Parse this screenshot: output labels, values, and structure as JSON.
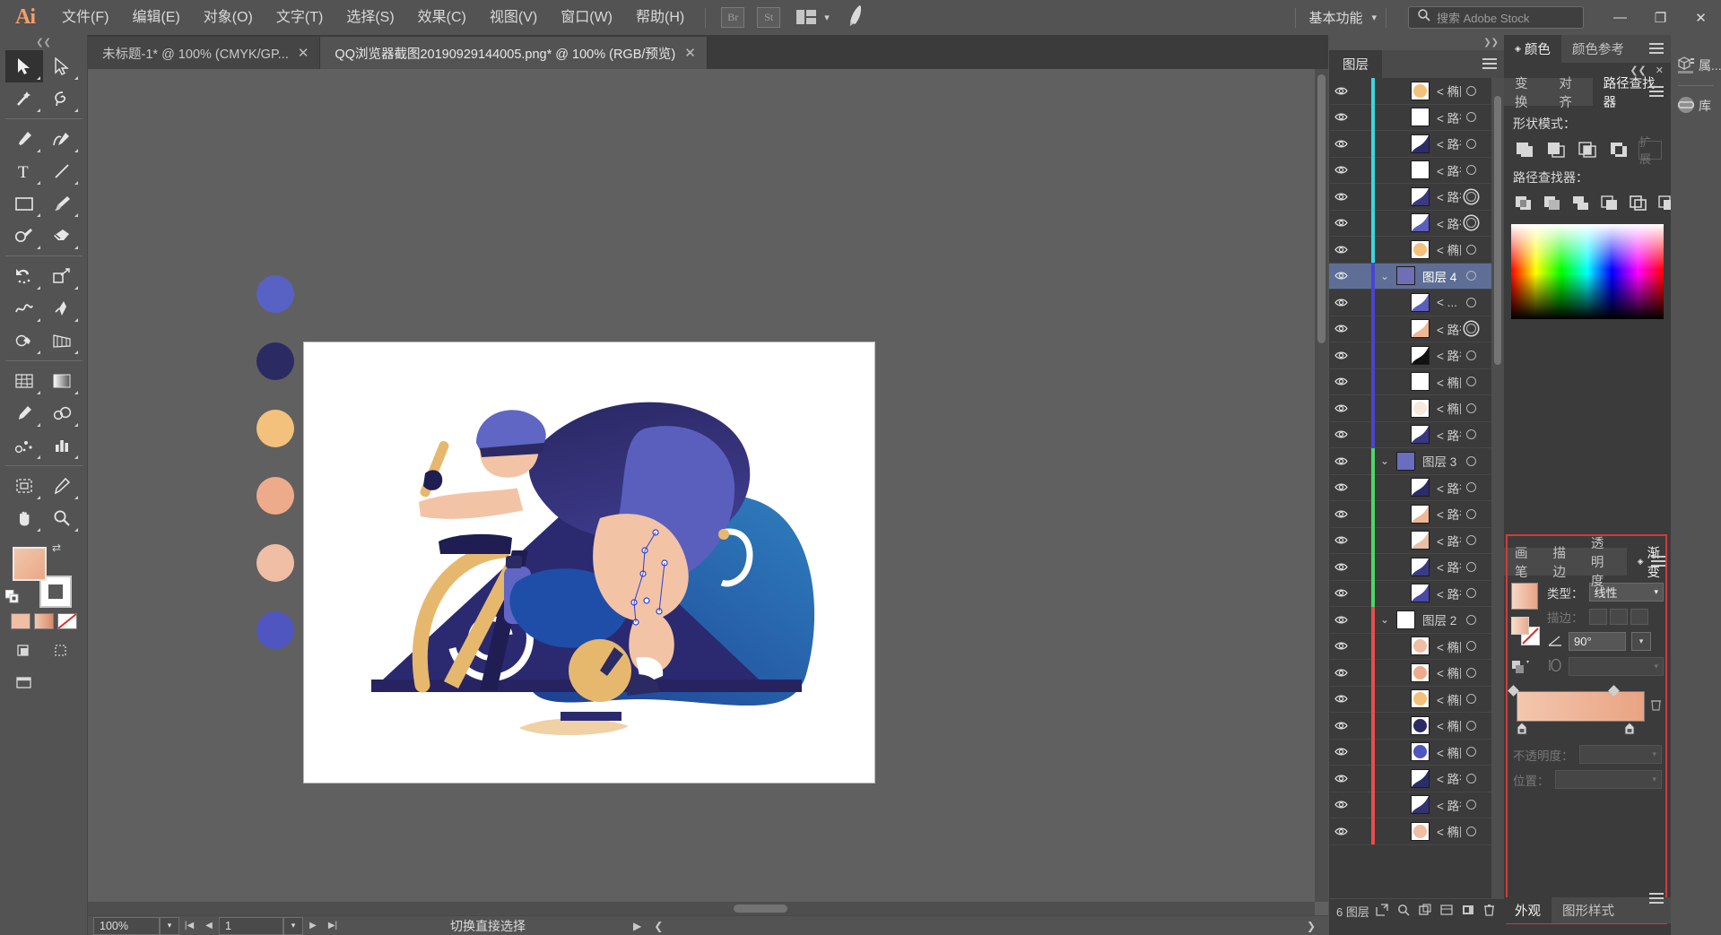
{
  "app": {
    "logo": "Ai",
    "menus": [
      "文件(F)",
      "编辑(E)",
      "对象(O)",
      "文字(T)",
      "选择(S)",
      "效果(C)",
      "视图(V)",
      "窗口(W)",
      "帮助(H)"
    ],
    "bridge_button": "Br",
    "stock_button": "St",
    "workspace": "基本功能",
    "search_placeholder": "搜索 Adobe Stock",
    "window_minimize": "—",
    "window_restore": "❐",
    "window_close": "✕"
  },
  "tabs": [
    {
      "label": "未标题-1* @ 100% (CMYK/GP...",
      "close": "✕",
      "active": false
    },
    {
      "label": "QQ浏览器截图20190929144005.png* @ 100% (RGB/预览)",
      "close": "✕",
      "active": true
    }
  ],
  "toolbar": {
    "tools": [
      "selection-tool",
      "direct-selection-tool",
      "magic-wand-tool",
      "lasso-tool",
      "pen-tool",
      "curvature-tool",
      "type-tool",
      "line-segment-tool",
      "rectangle-tool",
      "paintbrush-tool",
      "shaper-tool",
      "eraser-tool",
      "rotate-tool",
      "scale-tool",
      "width-tool",
      "free-transform-tool",
      "shape-builder-tool",
      "perspective-grid-tool",
      "mesh-tool",
      "gradient-tool",
      "eyedropper-tool",
      "blend-tool",
      "symbol-sprayer-tool",
      "column-graph-tool",
      "artboard-tool",
      "slice-tool",
      "hand-tool",
      "zoom-tool"
    ],
    "fill_color": "#eda888",
    "stroke_color": "#ffffff"
  },
  "canvas": {
    "swatch_dots": [
      "#5762c4",
      "#2c2a63",
      "#f3c17b",
      "#eeab8b",
      "#f0bda5",
      "#4f56c0"
    ],
    "artboard_bg": "#ffffff",
    "illustration_palette": {
      "dark_navy": "#2b2a63",
      "indigo": "#5a5fbe",
      "periwinkle": "#6066c4",
      "blue": "#1f4ea8",
      "skin": "#f3c3a6",
      "sand": "#e8b56f",
      "white": "#ffffff",
      "deep": "#22205a"
    }
  },
  "statusbar": {
    "zoom": "100%",
    "page": "1",
    "status_text": "切换直接选择",
    "first_icon": "|◀",
    "prev_icon": "◀",
    "next_icon": "▶",
    "last_icon": "▶|",
    "play_icon": "▶",
    "collapse_icon": "❮",
    "expand_icon": "❯"
  },
  "layers_panel": {
    "tab": "图层",
    "count_label": "6 图层",
    "footer_icons": [
      "make-clipping-mask-icon",
      "locate-object-icon",
      "create-sublayer-icon",
      "create-new-layer-icon",
      "collect-in-new-layer-icon",
      "delete-selection-icon"
    ],
    "rows": [
      {
        "name": "< 椭圆 >",
        "indent": 2,
        "color": "#3ad7e0",
        "thumb": "#f3c17b",
        "type": "ellipse",
        "selected": false,
        "expandable": false,
        "target": "single"
      },
      {
        "name": "< 路径 >",
        "indent": 2,
        "color": "#3ad7e0",
        "thumb": "#ffffff",
        "type": "path",
        "selected": false,
        "expandable": false,
        "target": "single"
      },
      {
        "name": "< 路径 >",
        "indent": 2,
        "color": "#3ad7e0",
        "thumb": "#2e2b6b",
        "type": "path",
        "selected": false,
        "expandable": false,
        "target": "single"
      },
      {
        "name": "< 路径 >",
        "indent": 2,
        "color": "#3ad7e0",
        "thumb": "#ffffff",
        "type": "path",
        "selected": false,
        "expandable": false,
        "target": "single"
      },
      {
        "name": "< 路径 >",
        "indent": 2,
        "color": "#3ad7e0",
        "thumb": "#3b3880",
        "type": "path",
        "selected": false,
        "expandable": false,
        "target": "double"
      },
      {
        "name": "< 路径 >",
        "indent": 2,
        "color": "#3ad7e0",
        "thumb": "#5a5fbe",
        "type": "path",
        "selected": false,
        "expandable": false,
        "target": "double"
      },
      {
        "name": "< 椭圆 >",
        "indent": 2,
        "color": "#3ad7e0",
        "thumb": "#f3c17b",
        "type": "ellipse",
        "selected": false,
        "expandable": false,
        "target": "single"
      },
      {
        "name": "图层 4",
        "indent": 1,
        "color": "#4a43d6",
        "thumb": "#6e6fb5",
        "type": "layer",
        "selected": true,
        "expandable": true,
        "target": "single",
        "has_square": true
      },
      {
        "name": "< ...",
        "indent": 2,
        "color": "#4a43d6",
        "thumb": "#5a5fbe",
        "type": "group",
        "selected": false,
        "expandable": false,
        "target": "single"
      },
      {
        "name": "< 路径 >",
        "indent": 2,
        "color": "#4a43d6",
        "thumb": "#f0b795",
        "type": "path",
        "selected": false,
        "expandable": false,
        "target": "double",
        "has_square": true
      },
      {
        "name": "< 路径 >",
        "indent": 2,
        "color": "#4a43d6",
        "thumb": "#111111",
        "type": "path",
        "selected": false,
        "expandable": false,
        "target": "single"
      },
      {
        "name": "< 椭圆 >",
        "indent": 2,
        "color": "#4a43d6",
        "thumb": "#ffffff",
        "type": "ellipse",
        "selected": false,
        "expandable": false,
        "target": "single"
      },
      {
        "name": "< 椭圆 >",
        "indent": 2,
        "color": "#4a43d6",
        "thumb": "#f7e9dc",
        "type": "ellipse",
        "selected": false,
        "expandable": false,
        "target": "single"
      },
      {
        "name": "< 路径 >",
        "indent": 2,
        "color": "#4a43d6",
        "thumb": "#3a3784",
        "type": "path",
        "selected": false,
        "expandable": false,
        "target": "single"
      },
      {
        "name": "图层 3",
        "indent": 1,
        "color": "#4cd964",
        "thumb": "#6a6ec0",
        "type": "layer",
        "selected": false,
        "expandable": true,
        "target": "single"
      },
      {
        "name": "< 路径 >",
        "indent": 2,
        "color": "#4cd964",
        "thumb": "#2d2b68",
        "type": "path",
        "selected": false,
        "expandable": false,
        "target": "single"
      },
      {
        "name": "< 路径 >",
        "indent": 2,
        "color": "#4cd964",
        "thumb": "#f0b795",
        "type": "path",
        "selected": false,
        "expandable": false,
        "target": "single"
      },
      {
        "name": "< 路径 >",
        "indent": 2,
        "color": "#4cd964",
        "thumb": "#e8c0a8",
        "type": "path",
        "selected": false,
        "expandable": false,
        "target": "single"
      },
      {
        "name": "< 路径 >",
        "indent": 2,
        "color": "#4cd964",
        "thumb": "#3c3a86",
        "type": "path",
        "selected": false,
        "expandable": false,
        "target": "single"
      },
      {
        "name": "< 路径 >",
        "indent": 2,
        "color": "#4cd964",
        "thumb": "#4a48a8",
        "type": "path",
        "selected": false,
        "expandable": false,
        "target": "single"
      },
      {
        "name": "图层 2",
        "indent": 1,
        "color": "#ec4c4c",
        "thumb": "#ffffff",
        "type": "layer",
        "selected": false,
        "expandable": true,
        "target": "single"
      },
      {
        "name": "< 椭圆 >",
        "indent": 2,
        "color": "#ec4c4c",
        "thumb": "#f0bda5",
        "type": "ellipse",
        "selected": false,
        "expandable": false,
        "target": "single"
      },
      {
        "name": "< 椭圆 >",
        "indent": 2,
        "color": "#ec4c4c",
        "thumb": "#eeab8b",
        "type": "ellipse",
        "selected": false,
        "expandable": false,
        "target": "single"
      },
      {
        "name": "< 椭圆 >",
        "indent": 2,
        "color": "#ec4c4c",
        "thumb": "#f3c17b",
        "type": "ellipse",
        "selected": false,
        "expandable": false,
        "target": "single"
      },
      {
        "name": "< 椭圆 >",
        "indent": 2,
        "color": "#ec4c4c",
        "thumb": "#2c2a63",
        "type": "ellipse",
        "selected": false,
        "expandable": false,
        "target": "single"
      },
      {
        "name": "< 椭圆 >",
        "indent": 2,
        "color": "#ec4c4c",
        "thumb": "#4f56c0",
        "type": "ellipse",
        "selected": false,
        "expandable": false,
        "target": "single"
      },
      {
        "name": "< 路径 >",
        "indent": 2,
        "color": "#ec4c4c",
        "thumb": "#2d2b68",
        "type": "path",
        "selected": false,
        "expandable": false,
        "target": "single"
      },
      {
        "name": "< 路径 >",
        "indent": 2,
        "color": "#ec4c4c",
        "thumb": "#34326f",
        "type": "path",
        "selected": false,
        "expandable": false,
        "target": "single"
      },
      {
        "name": "< 椭圆 >",
        "indent": 2,
        "color": "#ec4c4c",
        "thumb": "#f0bda5",
        "type": "ellipse",
        "selected": false,
        "expandable": false,
        "target": "single"
      }
    ]
  },
  "color_panel": {
    "tabs": [
      "颜色",
      "颜色参考"
    ],
    "active_tab": "颜色"
  },
  "pathfinder_panel": {
    "tabs": [
      "变换",
      "对齐",
      "路径查找器"
    ],
    "active_tab": "路径查找器",
    "shape_mode_label": "形状模式：",
    "pathfinder_label": "路径查找器：",
    "expand_label": "扩展",
    "collapse_icon": "❮❮",
    "close_icon": "✕",
    "shape_modes": [
      "unite-icon",
      "minus-front-icon",
      "intersect-icon",
      "exclude-icon"
    ],
    "pathfinders": [
      "divide-icon",
      "trim-icon",
      "merge-icon",
      "crop-icon",
      "outline-icon",
      "minus-back-icon"
    ]
  },
  "gradient_panel": {
    "tabs": [
      "画笔",
      "描边",
      "透明度",
      "渐变"
    ],
    "active_tab": "渐变",
    "type_label": "类型：",
    "type_value": "线性",
    "stroke_label": "描边：",
    "angle_label": "angle-icon",
    "angle_value": "90°",
    "aspect_label": "aspect-ratio-icon",
    "aspect_value": "",
    "opacity_label": "不透明度：",
    "opacity_value": "",
    "location_label": "位置：",
    "location_value": "",
    "gradient_start": "#f5cbb2",
    "gradient_end": "#e9a382",
    "delete_stop_icon": "trash-icon"
  },
  "appearance_panel": {
    "tabs": [
      "外观",
      "图形样式"
    ],
    "active_tab": "外观"
  },
  "far_right": {
    "items": [
      {
        "icon": "properties-icon",
        "label": "属..."
      },
      {
        "icon": "libraries-icon",
        "label": "库"
      }
    ]
  }
}
